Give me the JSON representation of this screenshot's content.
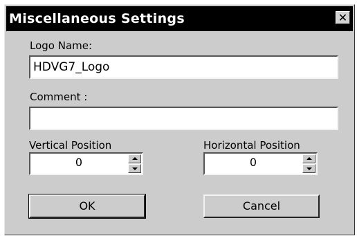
{
  "window": {
    "title": "Miscellaneous Settings",
    "close_glyph": "✕"
  },
  "logo_name": {
    "label": "Logo Name:",
    "value": "HDVG7_Logo"
  },
  "comment": {
    "label": "Comment :",
    "value": ""
  },
  "vertical_position": {
    "label": "Vertical Position",
    "value": "0"
  },
  "horizontal_position": {
    "label": "Horizontal Position",
    "value": "0"
  },
  "buttons": {
    "ok": "OK",
    "cancel": "Cancel"
  }
}
